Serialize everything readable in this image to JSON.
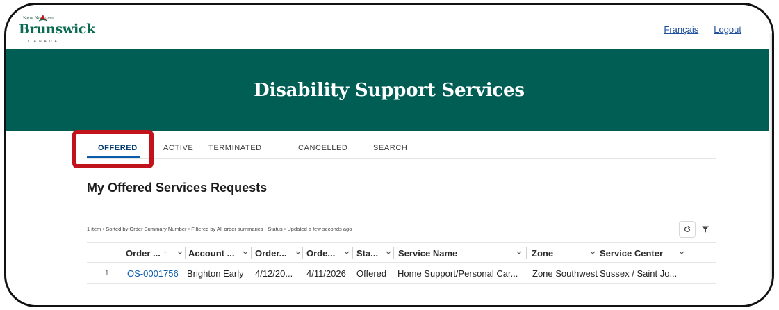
{
  "logo": {
    "top": "New  Nouveau",
    "wordmark": "Brunswick",
    "country": "CANADA"
  },
  "header_links": {
    "francais": "Français",
    "logout": "Logout"
  },
  "banner": {
    "title": "Disability Support Services"
  },
  "tabs": [
    {
      "label": "OFFERED",
      "active": true
    },
    {
      "label": "ACTIVE"
    },
    {
      "label": "TERMINATED"
    },
    {
      "label": "CANCELLED"
    },
    {
      "label": "SEARCH"
    }
  ],
  "list": {
    "heading": "My Offered Services Requests",
    "meta": "1 item • Sorted by Order Summary Number • Filtered by All order summaries - Status • Updated a few seconds ago",
    "columns": [
      "Order ...",
      "Account ...",
      "Order...",
      "Orde...",
      "Sta...",
      "Service Name",
      "Zone",
      "Service Center"
    ],
    "rows": [
      {
        "num": "1",
        "order": "OS-0001756",
        "account": "Brighton Early",
        "order_date": "4/12/20...",
        "orde": "4/11/2026",
        "status": "Offered",
        "service_name": "Home Support/Personal Car...",
        "zone": "Zone Southwest",
        "service_center": "Sussex / Saint Jo..."
      }
    ]
  },
  "colors": {
    "banner": "#005e55",
    "link": "#0b5cab",
    "highlight": "#c0131b"
  },
  "icons": [
    "refresh-icon",
    "filter-icon",
    "chevron-down-icon",
    "sort-up-arrow-icon"
  ]
}
